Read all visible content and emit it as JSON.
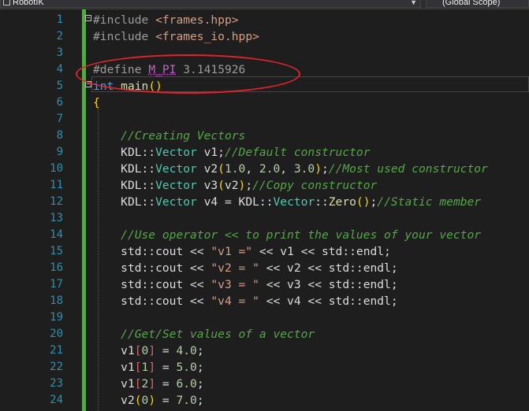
{
  "navbar": {
    "project": "RobotIK",
    "scope": "(Global Scope)"
  },
  "colors": {
    "background": "#1e1e1e",
    "line_number": "#2b91af",
    "change_bar": "#57a64a",
    "annotation": "#e0242c"
  },
  "line_numbers": [
    "1",
    "2",
    "3",
    "4",
    "5",
    "6",
    "7",
    "8",
    "9",
    "10",
    "11",
    "12",
    "13",
    "14",
    "15",
    "16",
    "17",
    "18",
    "19",
    "20",
    "21",
    "22",
    "23",
    "24"
  ],
  "code": {
    "l1": {
      "directive": "#include",
      "file": "<frames.hpp>"
    },
    "l2": {
      "directive": "#include",
      "file": "<frames_io.hpp>"
    },
    "l4": {
      "directive": "#define",
      "macro": "M_PI",
      "value": "3.1415926"
    },
    "l5": {
      "type": "int",
      "name": "main",
      "parens": "()"
    },
    "l7": {
      "brace": "{"
    },
    "l8": {
      "comment": "//Creating Vectors"
    },
    "l9": {
      "ns": "KDL",
      "sep": "::",
      "type": "Vector",
      "rest": " v1;",
      "comment": "//Default constructor"
    },
    "l10": {
      "ns": "KDL",
      "sep": "::",
      "type": "Vector",
      "v": " v2",
      "a1": "1.0",
      "a2": "2.0",
      "a3": "3.0",
      "comment": "//Most used constructor"
    },
    "l11": {
      "ns": "KDL",
      "sep": "::",
      "type": "Vector",
      "v": " v3",
      "arg": "v2",
      "comment": "//Copy constructor"
    },
    "l12": {
      "ns": "KDL",
      "sep": "::",
      "type": "Vector",
      "v": " v4 = ",
      "ns2": "KDL",
      "type2": "Vector",
      "fn": "Zero",
      "comment": "//Static member"
    },
    "l14": {
      "comment": "//Use operator << to print the values of your vector"
    },
    "l15": {
      "pre": "std::cout << ",
      "str": "\"v1 =\"",
      "post": " << v1 << std::endl;"
    },
    "l16": {
      "pre": "std::cout << ",
      "str": "\"v2 = \"",
      "post": " << v2 << std::endl;"
    },
    "l17": {
      "pre": "std::cout << ",
      "str": "\"v3 = \"",
      "post": " << v3 << std::endl;"
    },
    "l18": {
      "pre": "std::cout << ",
      "str": "\"v4 = \"",
      "post": " << v4 << std::endl;"
    },
    "l20": {
      "comment": "//Get/Set values of a vector"
    },
    "l21": {
      "var": "v1",
      "idx": "0",
      "val": "4.0"
    },
    "l22": {
      "var": "v1",
      "idx": "1",
      "val": "5.0"
    },
    "l23": {
      "var": "v1",
      "idx": "2",
      "val": "6.0"
    },
    "l24": {
      "var": "v2",
      "idx": "0",
      "val": "7.0"
    }
  }
}
